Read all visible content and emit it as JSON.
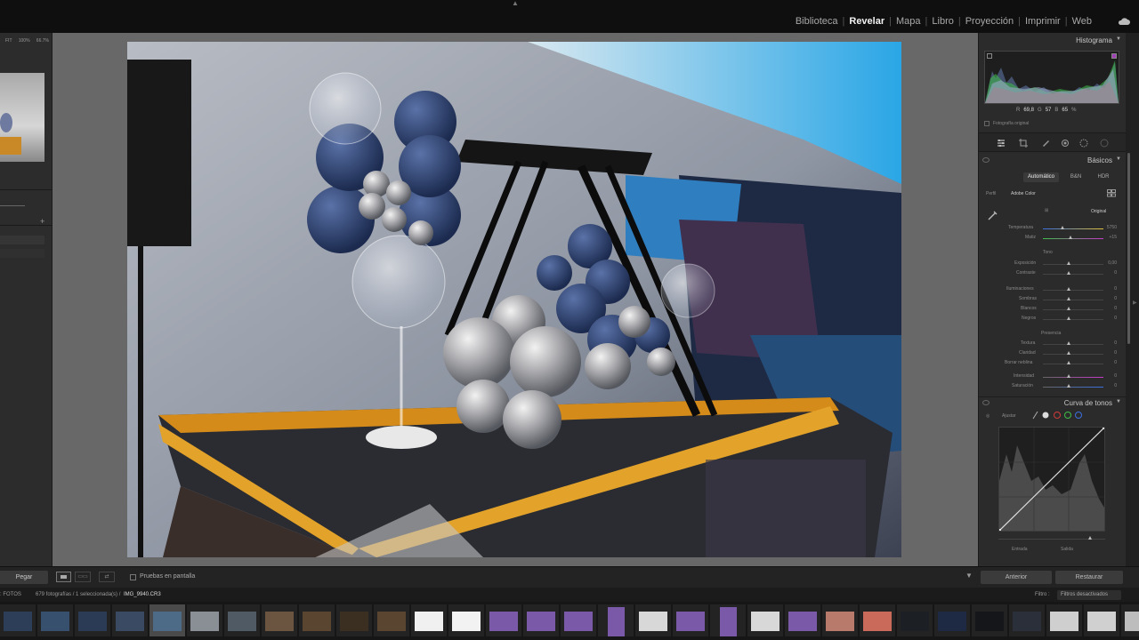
{
  "modules": [
    "Biblioteca",
    "Revelar",
    "Mapa",
    "Libro",
    "Proyección",
    "Imprimir",
    "Web"
  ],
  "active_module": "Revelar",
  "navigator": {
    "zoom_fit": "FIT",
    "zoom_100": "100%",
    "zoom_custom": "66.7%"
  },
  "toolbar": {
    "paste_label": "Pegar",
    "softproof_label": "Pruebas en pantalla",
    "previous_label": "Anterior",
    "reset_label": "Restaurar"
  },
  "filmstrip_header": {
    "source": ": FOTOS",
    "count": "679 fotografías / 1 seleccionada(s) /",
    "filename": "IMG_9940.CR3",
    "filter_label": "Filtro :",
    "filter_value": "Filtros desactivados"
  },
  "histogram": {
    "title": "Histograma",
    "r_label": "R",
    "r_value": "69,8",
    "g_label": "G",
    "g_value": "57",
    "b_label": "B",
    "b_value": "65",
    "pct": "%",
    "original_label": "Fotografía original"
  },
  "basic": {
    "title": "Básicos",
    "treatments": [
      "Automático",
      "B&N",
      "HDR"
    ],
    "profile_label": "Perfil",
    "profile_value": "Adobe Color",
    "wb_value": "Original",
    "temp_label": "Temperatura",
    "temp_value": "5750",
    "tint_label": "Matiz",
    "tint_value": "+15",
    "tone_header": "Tono",
    "exposure_label": "Exposición",
    "exposure_value": "0,00",
    "contrast_label": "Contraste",
    "contrast_value": "0",
    "highlights_label": "Iluminaciones",
    "highlights_value": "0",
    "shadows_label": "Sombras",
    "shadows_value": "0",
    "whites_label": "Blancos",
    "whites_value": "0",
    "blacks_label": "Negros",
    "blacks_value": "0",
    "presence_header": "Presencia",
    "texture_label": "Textura",
    "texture_value": "0",
    "clarity_label": "Claridad",
    "clarity_value": "0",
    "dehaze_label": "Borrar neblina",
    "dehaze_value": "0",
    "vibrance_label": "Intensidad",
    "vibrance_value": "0",
    "saturation_label": "Saturación",
    "saturation_value": "0"
  },
  "tone_curve": {
    "title": "Curva de tonos",
    "adjust_label": "Ajustar",
    "input_label": "Entrada",
    "output_label": "Salida"
  },
  "colors": {
    "accent": "#5fa0e0",
    "red_channel": "#d23a3a",
    "green_channel": "#3fbf4a",
    "blue_channel": "#3a6fe0",
    "clip_highlight": "#a03fb5"
  }
}
